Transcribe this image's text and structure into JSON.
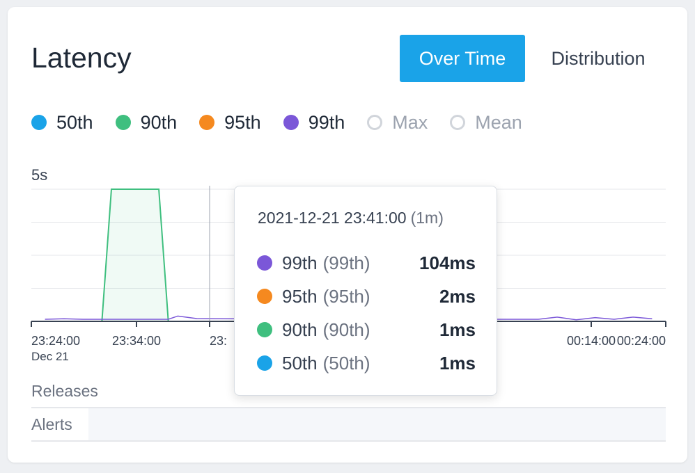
{
  "header": {
    "title": "Latency",
    "tabs": [
      {
        "label": "Over Time",
        "active": true
      },
      {
        "label": "Distribution",
        "active": false
      }
    ]
  },
  "legend": [
    {
      "label": "50th",
      "color": "#1aa3e8",
      "enabled": true
    },
    {
      "label": "90th",
      "color": "#3fbf7f",
      "enabled": true
    },
    {
      "label": "95th",
      "color": "#f5891f",
      "enabled": true
    },
    {
      "label": "99th",
      "color": "#7b57d8",
      "enabled": true
    },
    {
      "label": "Max",
      "color": "#d1d5db",
      "enabled": false
    },
    {
      "label": "Mean",
      "color": "#d1d5db",
      "enabled": false
    }
  ],
  "chart_data": {
    "type": "line",
    "y_max_label": "5s",
    "ylim": [
      0,
      5
    ],
    "y_unit": "s",
    "x_tick_labels": [
      "23:24:00",
      "23:34:00",
      "23:",
      "00:14:00",
      "00:24:00"
    ],
    "x_date_label": "Dec 21",
    "series": [
      {
        "name": "90th",
        "color": "#3fbf7f",
        "x": [
          "23:24:00",
          "23:31:00",
          "23:32:00",
          "23:37:00",
          "23:38:00",
          "00:30:00"
        ],
        "values": [
          0,
          0,
          5,
          5,
          0,
          0
        ]
      },
      {
        "name": "99th",
        "color": "#7b57d8",
        "x": [
          "23:25:00",
          "23:27:00",
          "23:29:00",
          "23:38:00",
          "23:39:00",
          "23:41:00",
          "23:43:00",
          "00:10:00",
          "00:12:00",
          "00:14:00",
          "00:17:00",
          "00:19:00",
          "00:21:00",
          "00:23:00",
          "00:25:00",
          "00:27:00",
          "00:29:00"
        ],
        "values": [
          0.08,
          0.1,
          0.08,
          0.08,
          0.2,
          0.104,
          0.1,
          0.08,
          0.08,
          0.08,
          0.08,
          0.16,
          0.06,
          0.14,
          0.08,
          0.16,
          0.1
        ]
      },
      {
        "name": "50th",
        "color": "#1aa3e8",
        "x": [
          "23:24:00",
          "00:30:00"
        ],
        "values": [
          0.001,
          0.001
        ]
      }
    ]
  },
  "tooltip": {
    "datetime": "2021-12-21 23:41:00",
    "duration": "(1m)",
    "rows": [
      {
        "name": "99th",
        "alias": "(99th)",
        "value": "104ms",
        "color": "#7b57d8"
      },
      {
        "name": "95th",
        "alias": "(95th)",
        "value": "2ms",
        "color": "#f5891f"
      },
      {
        "name": "90th",
        "alias": "(90th)",
        "value": "1ms",
        "color": "#3fbf7f"
      },
      {
        "name": "50th",
        "alias": "(50th)",
        "value": "1ms",
        "color": "#1aa3e8"
      }
    ]
  },
  "sections": {
    "releases": "Releases",
    "alerts": "Alerts"
  }
}
